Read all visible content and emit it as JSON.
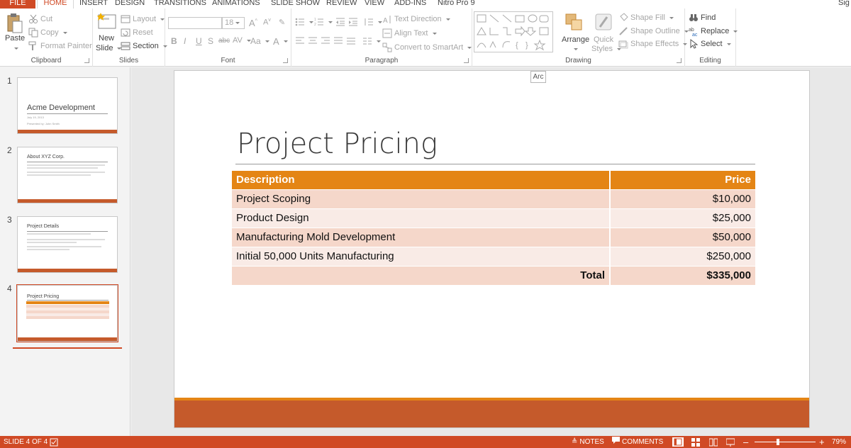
{
  "tabs": {
    "file": "FILE",
    "home": "HOME",
    "insert": "INSERT",
    "design": "DESIGN",
    "transitions": "TRANSITIONS",
    "animations": "ANIMATIONS",
    "slideshow": "SLIDE SHOW",
    "review": "REVIEW",
    "view": "VIEW",
    "addins": "ADD-INS",
    "nitro": "Nitro Pro 9",
    "signin": "Sig"
  },
  "clipboard": {
    "paste": "Paste",
    "cut": "Cut",
    "copy": "Copy",
    "format_painter": "Format Painter",
    "label": "Clipboard"
  },
  "slides_group": {
    "new_slide_1": "New",
    "new_slide_2": "Slide",
    "layout": "Layout",
    "reset": "Reset",
    "section": "Section",
    "label": "Slides"
  },
  "font_group": {
    "size": "18",
    "label": "Font",
    "bold": "B",
    "italic": "I",
    "underline": "U",
    "shadow": "S",
    "strike": "abc",
    "spacing": "AV",
    "case": "Aa",
    "color": "A"
  },
  "paragraph": {
    "text_direction": "Text Direction",
    "align_text": "Align Text",
    "convert_smartart": "Convert to SmartArt",
    "label": "Paragraph"
  },
  "drawing": {
    "arrange": "Arrange",
    "quick_styles_1": "Quick",
    "quick_styles_2": "Styles",
    "shape_fill": "Shape Fill",
    "shape_outline": "Shape Outline",
    "shape_effects": "Shape Effects",
    "label": "Drawing"
  },
  "editing": {
    "find": "Find",
    "replace": "Replace",
    "select": "Select",
    "label": "Editing"
  },
  "thumbnails": [
    {
      "num": "1",
      "title": "Acme Development",
      "sub1": "July 19, 2013",
      "sub2": "Presented by: John Smith"
    },
    {
      "num": "2",
      "title": "About XYZ Corp."
    },
    {
      "num": "3",
      "title": "Project Details"
    },
    {
      "num": "4",
      "title": "Project Pricing"
    }
  ],
  "slide": {
    "tooltip": "Arc",
    "title": "Project Pricing",
    "table": {
      "headers": [
        "Description",
        "Price"
      ],
      "rows": [
        [
          "Project Scoping",
          "$10,000"
        ],
        [
          "Product Design",
          "$25,000"
        ],
        [
          "Manufacturing Mold Development",
          "$50,000"
        ],
        [
          "Initial 50,000 Units Manufacturing",
          "$250,000"
        ]
      ],
      "total_label": "Total",
      "total_value": "$335,000"
    }
  },
  "status": {
    "slide_info": "SLIDE 4 OF 4",
    "notes": "NOTES",
    "comments": "COMMENTS",
    "zoom": "79%",
    "minus": "–",
    "plus": "+"
  },
  "colors": {
    "accent": "#d04a25",
    "table_header": "#e48515",
    "footer": "#c55a2b"
  }
}
